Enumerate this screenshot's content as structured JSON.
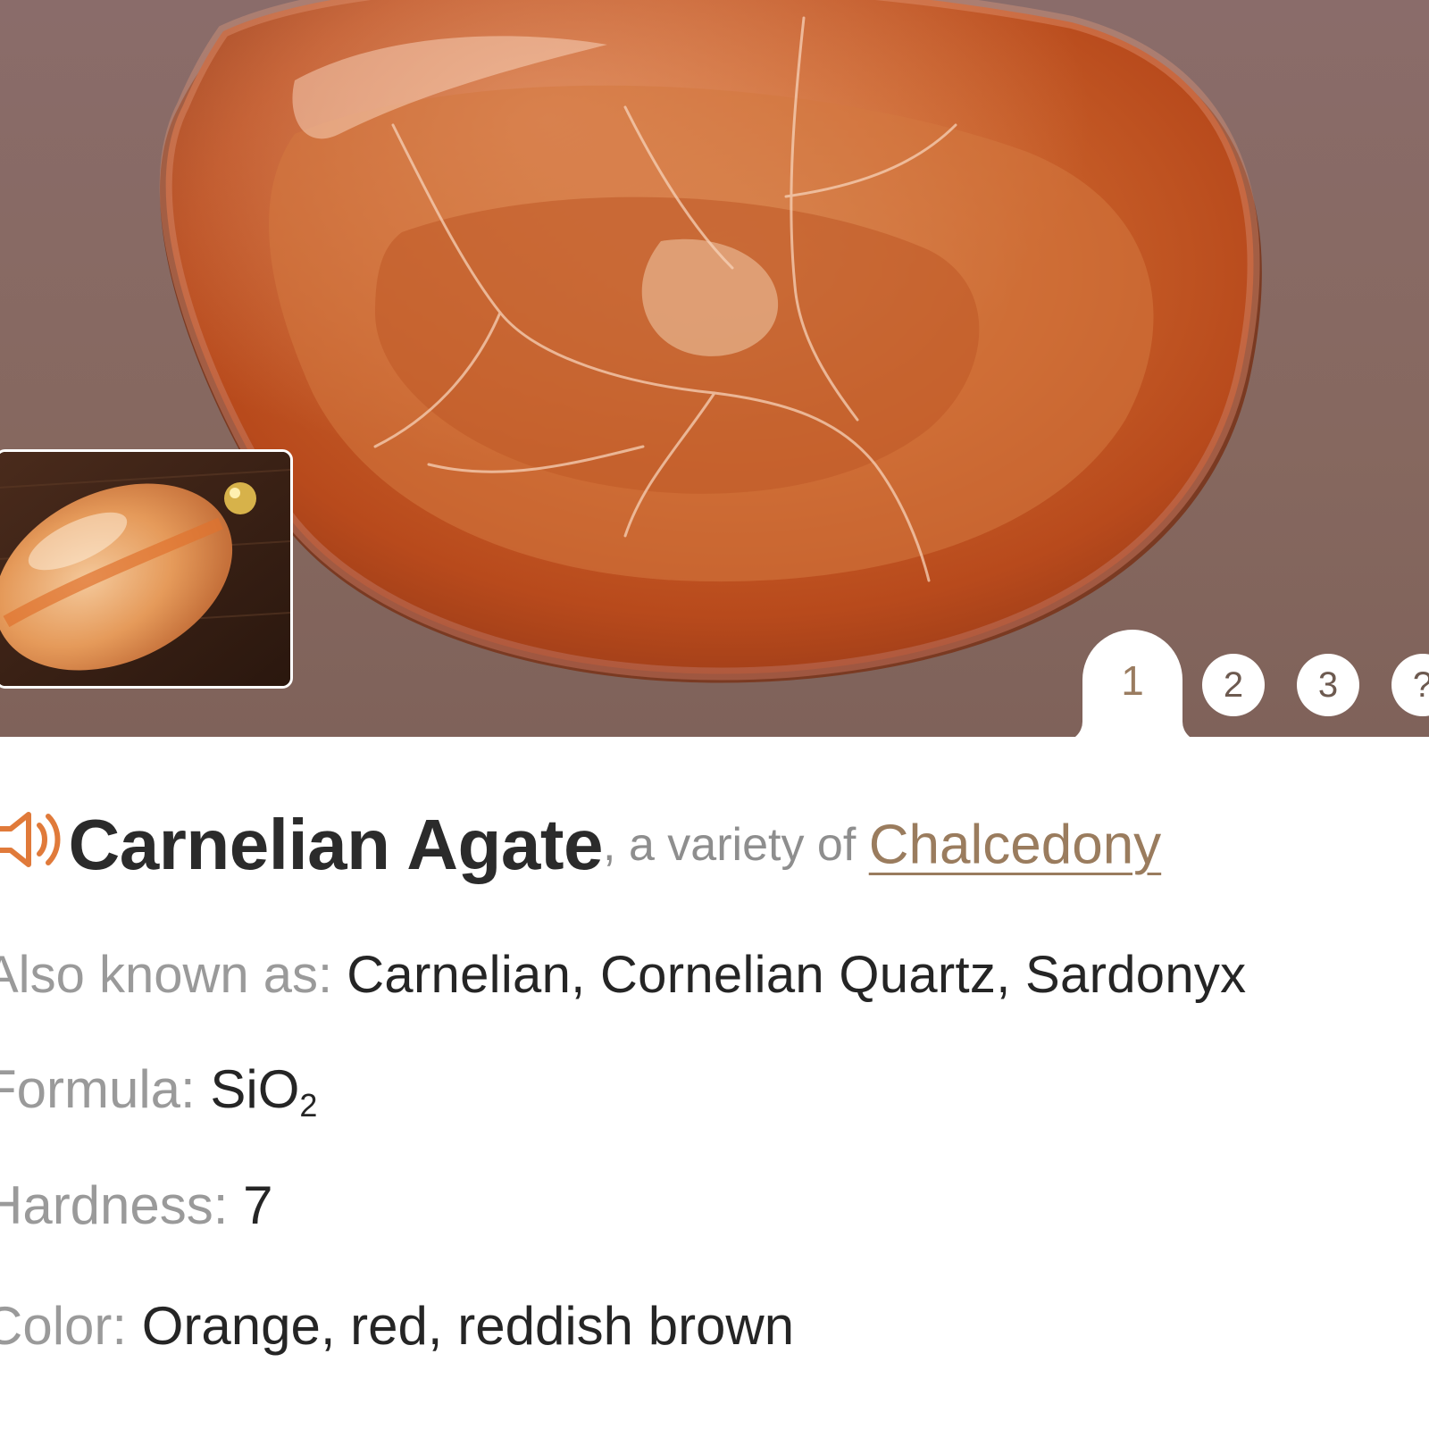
{
  "pager": {
    "pages": [
      "1",
      "2",
      "3",
      "?"
    ],
    "active_index": 0
  },
  "mineral": {
    "name": "Carnelian Agate",
    "variety_prefix": ", a variety of ",
    "variety_of": "Chalcedony"
  },
  "properties": {
    "aka_label": "Also known as: ",
    "aka_value": "Carnelian, Cornelian Quartz, Sardonyx",
    "formula_label": "Formula: ",
    "formula_main": "SiO",
    "formula_sub": "2",
    "hardness_label": "Hardness: ",
    "hardness_value": "7",
    "color_label": "Color: ",
    "color_value": "Orange, red, reddish brown"
  },
  "icons": {
    "speaker": "speaker-icon"
  },
  "colors": {
    "accent_link": "#9a7c5e",
    "speaker": "#e07a3a",
    "hero_bg": "#86685f",
    "stone": "#c65a28"
  }
}
